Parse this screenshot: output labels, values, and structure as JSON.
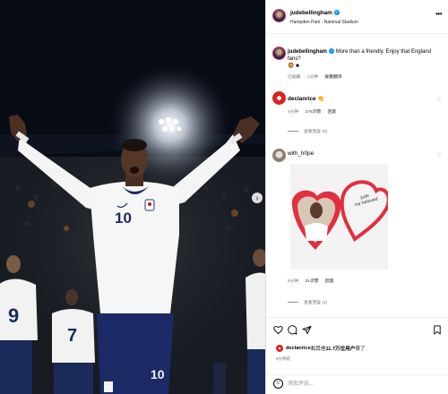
{
  "post": {
    "author": "judebellingham",
    "location": "Hampden Park - National Stadium",
    "more_label": "•••",
    "next_label": "›",
    "caption": {
      "username": "judebellingham",
      "text": "More than a friendly. Enjoy that England fans?",
      "emoji": "🦁 ■",
      "time": "已編輯",
      "time2": "1分钟",
      "translate": "查看翻译"
    }
  },
  "comments": [
    {
      "username": "declanrice",
      "text": "👏",
      "time": "4分钟",
      "likes": "275次赞",
      "reply": "回复",
      "view_replies": "查看回复 (6)"
    },
    {
      "username": "with_h0pe",
      "text": "",
      "image_text": "jude\nmy beloved",
      "time": "5分钟",
      "likes": "21次赞",
      "reply": "回复",
      "view_replies": "查看回复 (1)"
    }
  ],
  "actions": {
    "like_icon": "heart-icon",
    "comment_icon": "comment-icon",
    "share_icon": "share-icon",
    "save_icon": "bookmark-icon"
  },
  "liked_by": {
    "user": "declanrice",
    "text_mid": "和其他",
    "count": "11.7万位用户",
    "text_end": "赞了"
  },
  "posted_ago": "8分钟前",
  "comment_input": {
    "placeholder": "添加评论..."
  },
  "player": {
    "shirt_number": "10",
    "teammate_numbers": [
      "9",
      "7"
    ]
  },
  "colors": {
    "accent": "#0095f6",
    "rice_red": "#d9231f",
    "heart_red": "#e0303f"
  }
}
